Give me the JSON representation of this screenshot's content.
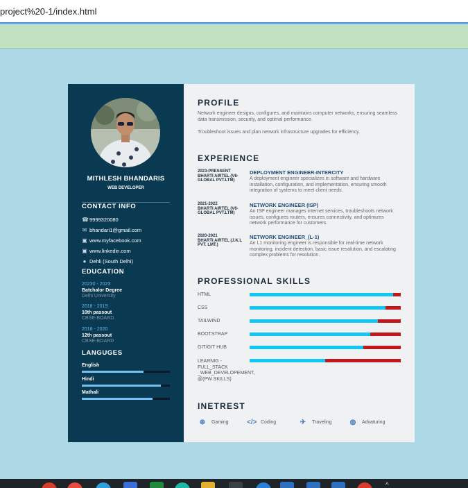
{
  "browser": {
    "url": "project%20-1/index.html"
  },
  "profile": {
    "name": "MITHLESH BHANDARIS",
    "role": "WEB DEVELOPER"
  },
  "contact": {
    "title": "CONTACT INFO",
    "items": [
      {
        "icon": "phone-icon",
        "text": "9999320080"
      },
      {
        "icon": "mail-icon",
        "text": "bhandari1@gmail.com"
      },
      {
        "icon": "facebook-icon",
        "text": "www.myfacebook.com"
      },
      {
        "icon": "linkedin-icon",
        "text": "www.linkedin.com"
      },
      {
        "icon": "location-icon",
        "text": "Dehli (South Delhi)"
      }
    ]
  },
  "education": {
    "title": "EDUCATION",
    "items": [
      {
        "year": "20230 - 2023",
        "degree": "Batchalor Degree",
        "institute": "Delhi University"
      },
      {
        "year": "2018 - 2019",
        "degree": "10th passout",
        "institute": "CBSE-BOARD"
      },
      {
        "year": "2018 - 2020",
        "degree": "12th passout",
        "institute": "CBSE-BOARD"
      }
    ]
  },
  "languages": {
    "title": "LANGUGES",
    "items": [
      {
        "name": "English",
        "level": 0.7
      },
      {
        "name": "Hindi",
        "level": 0.9
      },
      {
        "name": "Mathali",
        "level": 0.8
      }
    ]
  },
  "about": {
    "title": "PROFILE",
    "p1": "Network engineer designs, configures, and maintains computer networks, ensuring seamless data transmission, security, and optimal performance.",
    "p2": "Troubleshoot issues and plan network infrastructure upgrades for efficiency."
  },
  "experience": {
    "title": "EXPERIENCE",
    "items": [
      {
        "period": "2023-PRESSENT",
        "company": "BHARTI AIRTEL (V6-GLOBAL PVT.LTM)",
        "title": "DEPLOYMENT ENGINEER-INTERCITY",
        "desc": "A deployment engineer specializes in software and hardware installation, configuration, and implementation, ensuring smooth integration of systems to meet client needs."
      },
      {
        "period": "2021-2022",
        "company": "BHARTI AIRTEL (V6-GLOBAL PVT.LTM)",
        "title": "NETWORK ENGINEER (ISP)",
        "desc": "An ISP engineer manages internet services, troubleshoots network issues, configures routers, ensures connectivity, and optimizes network performance for customers."
      },
      {
        "period": "2020-2021",
        "company": "BHARTI AIRTEL (J.K.L PVT. LMT.)",
        "title": "NETWORK ENGINEER_(L-1)",
        "desc": "An L1 monitoring engineer is responsible for real-time network monitoring, incident detection, basic issue resolution, and escalating complex problems for resolution."
      }
    ]
  },
  "skills": {
    "title": "PROFESSIONAL SKILLS",
    "items": [
      {
        "name": "HTML",
        "level": 0.95
      },
      {
        "name": "CSS",
        "level": 0.9
      },
      {
        "name": "TAILWIND",
        "level": 0.85
      },
      {
        "name": "BOOTSTRAP",
        "level": 0.8
      },
      {
        "name": "GIT/GIT HUB",
        "level": 0.75
      },
      {
        "name": "LEARNIG - FULL_STACK _WEB_DEVELOPEMENT, @(PW SKILLS)",
        "level": 0.5
      }
    ]
  },
  "interests": {
    "title": "INETREST",
    "items": [
      {
        "icon": "gamepad-icon",
        "label": "Gaming"
      },
      {
        "icon": "code-icon",
        "label": "Coding"
      },
      {
        "icon": "plane-icon",
        "label": "Traveling"
      },
      {
        "icon": "globe-icon",
        "label": "Advaturing"
      }
    ]
  },
  "colors": {
    "sidebar": "#0a3a52",
    "skill_fill": "#14c6f3",
    "skill_track": "#c0181f",
    "page_bg": "#add8e6"
  }
}
